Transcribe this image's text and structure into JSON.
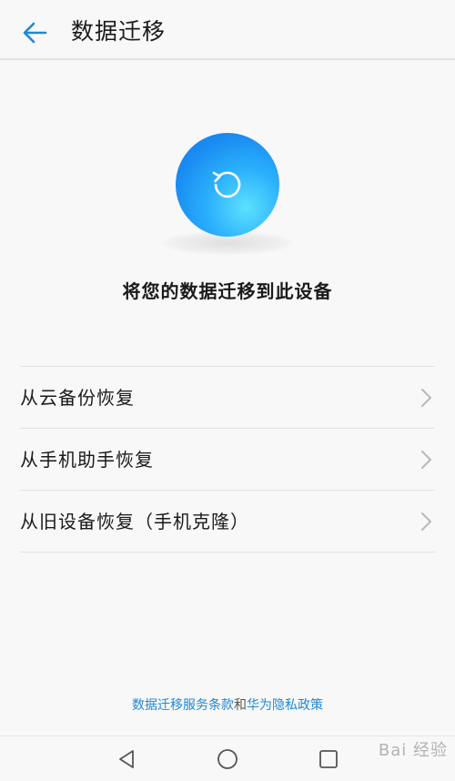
{
  "header": {
    "back_icon": "arrow-left-icon",
    "title": "数据迁移"
  },
  "hero": {
    "logo_icon": "sync-restore-icon",
    "subtitle": "将您的数据迁移到此设备"
  },
  "options": [
    {
      "label": "从云备份恢复",
      "icon": "chevron-right-icon"
    },
    {
      "label": "从手机助手恢复",
      "icon": "chevron-right-icon"
    },
    {
      "label": "从旧设备恢复（手机克隆）",
      "icon": "chevron-right-icon"
    }
  ],
  "footer": {
    "terms_link": "数据迁移服务条款",
    "conjunction": "和",
    "privacy_link": "华为隐私政策"
  },
  "navbar": {
    "back_icon": "triangle-back-icon",
    "home_icon": "circle-home-icon",
    "recent_icon": "square-recent-icon"
  },
  "watermark": {
    "text": "Bai 经验"
  },
  "colors": {
    "accent": "#1f88d6",
    "logo_blue": "#1a8df2",
    "background": "#f8f8f8"
  }
}
